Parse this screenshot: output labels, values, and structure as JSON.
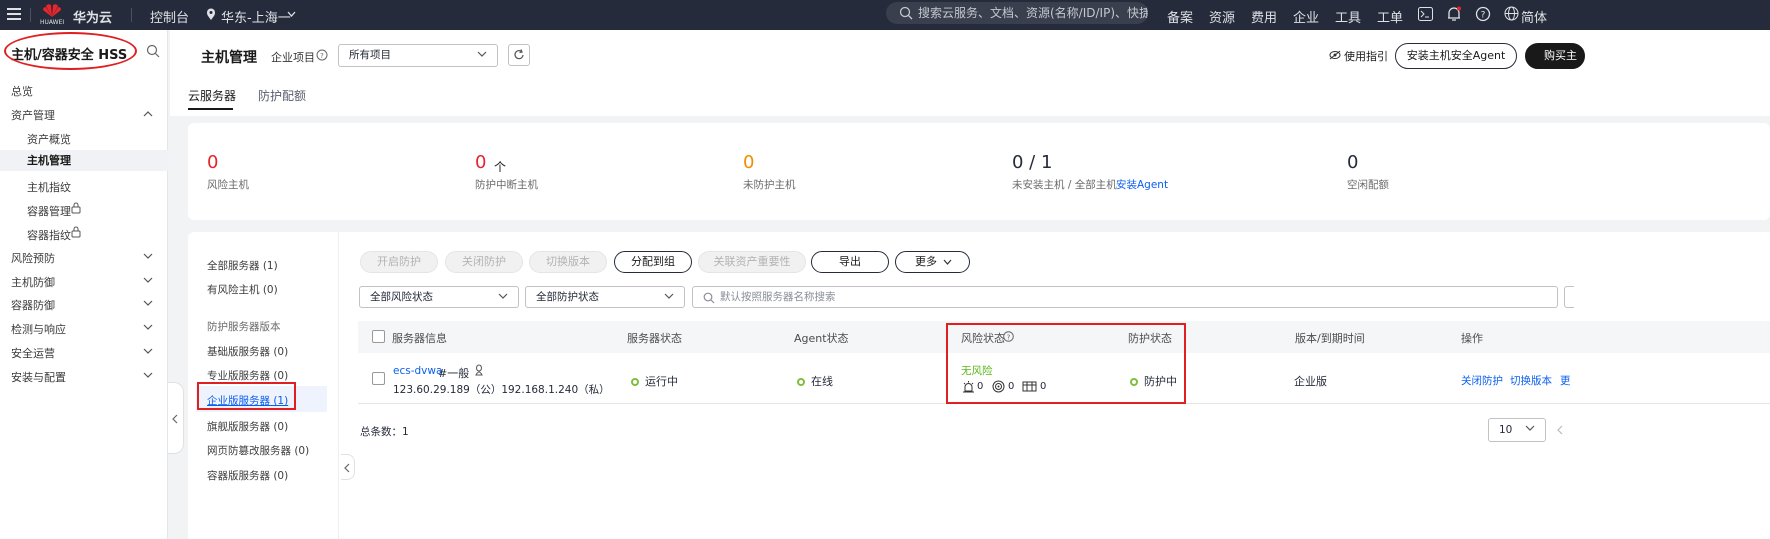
{
  "topbar": {
    "logo_text": "华为云",
    "logo_sub": "HUAWEI",
    "console": "控制台",
    "region": "华东-上海一",
    "search_placeholder": "搜索云服务、文档、资源(名称/ID/IP)、快捷...",
    "links": [
      "备案",
      "资源",
      "费用",
      "企业",
      "工具",
      "工单"
    ],
    "lang": "简体"
  },
  "sidebar": {
    "title": "主机/容器安全 HSS",
    "items": [
      {
        "label": "总览"
      },
      {
        "label": "资产管理"
      },
      {
        "label": "资产概览"
      },
      {
        "label": "主机管理"
      },
      {
        "label": "主机指纹"
      },
      {
        "label": "容器管理"
      },
      {
        "label": "容器指纹"
      },
      {
        "label": "风险预防"
      },
      {
        "label": "主机防御"
      },
      {
        "label": "容器防御"
      },
      {
        "label": "检测与响应"
      },
      {
        "label": "安全运营"
      },
      {
        "label": "安装与配置"
      }
    ]
  },
  "header": {
    "page_title": "主机管理",
    "project_label": "企业项目",
    "project_value": "所有项目",
    "guide": "使用指引",
    "install_agent": "安装主机安全Agent",
    "buy": "购买主"
  },
  "tabs": [
    "云服务器",
    "防护配额"
  ],
  "stats": [
    {
      "value": "0",
      "label": "风险主机",
      "color": "#e6242d"
    },
    {
      "value": "0",
      "label": "防护中断主机",
      "color": "#e6242d",
      "suffix": "个"
    },
    {
      "value": "0",
      "label": "未防护主机",
      "color": "#f28c00"
    },
    {
      "value": "0 / 1",
      "label": "未安装主机 / 全部主机",
      "link": "安装Agent",
      "color": "#252b3a"
    },
    {
      "value": "0",
      "label": "空闲配额",
      "color": "#252b3a"
    }
  ],
  "left_filters": {
    "all": "全部服务器 (1)",
    "risky": "有风险主机 (0)",
    "version_header": "防护服务器版本",
    "versions": [
      "基础版服务器 (0)",
      "专业版服务器 (0)",
      "企业版服务器 (1)",
      "旗舰版服务器 (0)",
      "网页防篡改服务器 (0)",
      "容器版服务器 (0)"
    ]
  },
  "toolbar": {
    "buttons": [
      "开启防护",
      "关闭防护",
      "切换版本",
      "分配到组",
      "关联资产重要性",
      "导出",
      "更多"
    ]
  },
  "filters": {
    "risk": "全部风险状态",
    "protect": "全部防护状态",
    "search_placeholder": "默认按照服务器名称搜索"
  },
  "table": {
    "headers": [
      "服务器信息",
      "服务器状态",
      "Agent状态",
      "风险状态",
      "防护状态",
      "版本/到期时间",
      "操作"
    ],
    "row": {
      "name": "ecs-dvwa",
      "tag": "#一般",
      "ips": "123.60.29.189（公）192.168.1.240（私）",
      "server_status": "运行中",
      "agent_status": "在线",
      "risk": "无风险",
      "risk_counts": [
        "0",
        "0",
        "0"
      ],
      "protect_status": "防护中",
      "version": "企业版",
      "actions": [
        "关闭防护",
        "切换版本",
        "更"
      ]
    },
    "total": "总条数：1",
    "page_size": "10"
  }
}
